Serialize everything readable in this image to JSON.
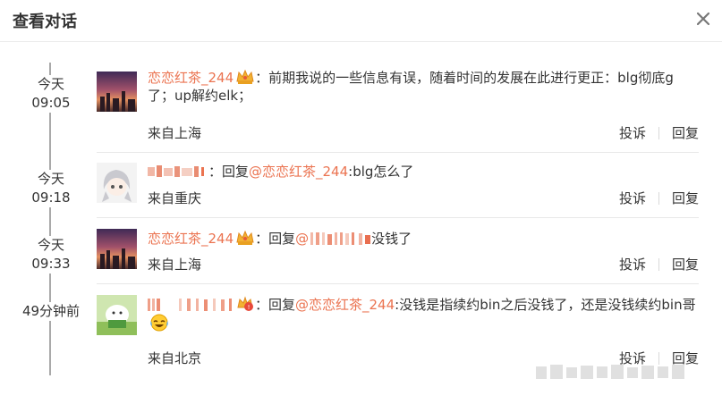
{
  "dialog": {
    "title": "查看对话",
    "close_icon": "close-icon"
  },
  "comments": [
    {
      "time_day": "今天",
      "time_clock": "09:05",
      "username": "恋恋红茶_244",
      "badge": "crown-badge-icon",
      "content": "：前期我说的一些信息有误，随着时间的发展在此进行更正：blg彻底g了；up解约elk；",
      "location": "来自上海",
      "report": "投诉",
      "reply": "回复"
    },
    {
      "time_day": "今天",
      "time_clock": "09:18",
      "username_masked": true,
      "content_prefix": "：回复",
      "mention": "@恋恋红茶_244",
      "content_suffix": ":blg怎么了",
      "location": "来自重庆",
      "report": "投诉",
      "reply": "回复"
    },
    {
      "time_day": "今天",
      "time_clock": "09:33",
      "username": "恋恋红茶_244",
      "badge": "crown-badge-icon",
      "content_prefix": "：回复",
      "mention": "@",
      "content_suffix": "没钱了",
      "location": "来自上海",
      "report": "投诉",
      "reply": "回复"
    },
    {
      "time_relative": "49分钟前",
      "username_masked": true,
      "badge": "vip-badge-icon",
      "content_prefix": "：回复",
      "mention": "@恋恋红茶_244",
      "content_suffix": ":没钱是指续约bin之后没钱了，还是没钱续约bin哥",
      "emoji": "laugh-cry-emoji",
      "location": "来自北京",
      "report": "投诉",
      "reply": "回复"
    }
  ],
  "colors": {
    "accent": "#eb7350",
    "text": "#333333",
    "timeline": "#a9a9a9"
  }
}
